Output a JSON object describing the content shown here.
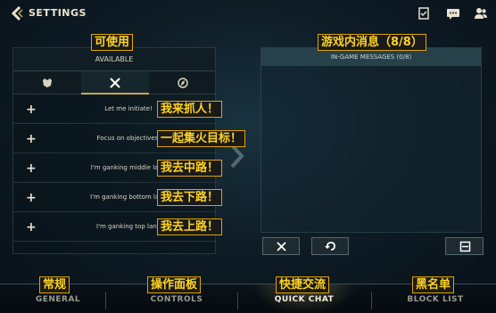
{
  "header": {
    "title": "SETTINGS"
  },
  "left_panel": {
    "annotation": "可使用",
    "title": "AVAILABLE",
    "rows": [
      {
        "text": "Let me initiate!",
        "annotation": "我来抓人！"
      },
      {
        "text": "Focus on objectives.",
        "annotation": "一起集火目标！"
      },
      {
        "text": "I'm ganking middle lane",
        "annotation": "我去中路！"
      },
      {
        "text": "I'm ganking bottom lane",
        "annotation": "我去下路！"
      },
      {
        "text": "I'm ganking top lane",
        "annotation": "我去上路！"
      }
    ]
  },
  "right_panel": {
    "annotation": "游戏内消息（8/8）",
    "title": "IN-GAME MESSAGES (0/8)"
  },
  "bottom_nav": [
    {
      "label": "GENERAL",
      "annotation": "常规"
    },
    {
      "label": "CONTROLS",
      "annotation": "操作面板"
    },
    {
      "label": "QUICK CHAT",
      "annotation": "快捷交流"
    },
    {
      "label": "BLOCK LIST",
      "annotation": "黑名单"
    }
  ],
  "colors": {
    "accent": "#d9b860",
    "annotation_text": "#ffd320",
    "annotation_border": "#e0a400"
  },
  "icons": [
    "back-arrow-icon",
    "checklist-icon",
    "chat-icon",
    "friends-icon",
    "helmet-icon",
    "crossed-swords-icon",
    "compass-icon",
    "plus-icon",
    "close-icon",
    "undo-icon",
    "save-icon",
    "chevron-right-icon"
  ]
}
